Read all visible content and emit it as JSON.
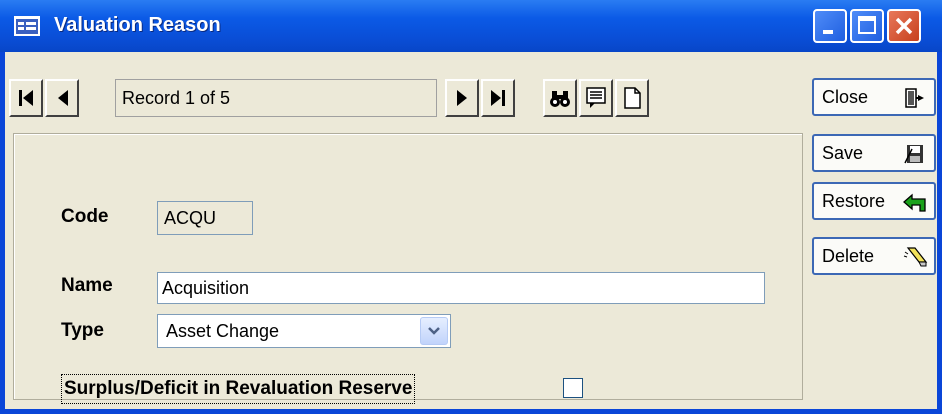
{
  "window": {
    "title": "Valuation Reason",
    "app_icon": "form-icon",
    "controls": [
      "minimize-icon",
      "maximize-icon",
      "close-icon"
    ]
  },
  "nav": {
    "record_status": "Record 1 of 5",
    "icons": [
      "first-record-icon",
      "prev-record-icon",
      "next-record-icon",
      "last-record-icon",
      "find-binoculars-icon",
      "list-icon",
      "new-record-icon"
    ]
  },
  "form": {
    "code": {
      "label": "Code",
      "value": "ACQU"
    },
    "name": {
      "label": "Name",
      "value": "Acquisition"
    },
    "type": {
      "label": "Type",
      "value": "Asset Change"
    },
    "surplus": {
      "label": "Surplus/Deficit in Revaluation Reserve",
      "checked": false
    }
  },
  "buttons": {
    "close": {
      "label": "Close",
      "icon": "exit-door-icon"
    },
    "save": {
      "label": "Save",
      "icon": "save-disk-icon"
    },
    "restore": {
      "label": "Restore",
      "icon": "undo-arrow-icon"
    },
    "delete": {
      "label": "Delete",
      "icon": "eraser-icon"
    }
  },
  "colors": {
    "titlebar": "#0a4fd8",
    "client": "#ece9d8",
    "button_border": "#3c68b5"
  }
}
